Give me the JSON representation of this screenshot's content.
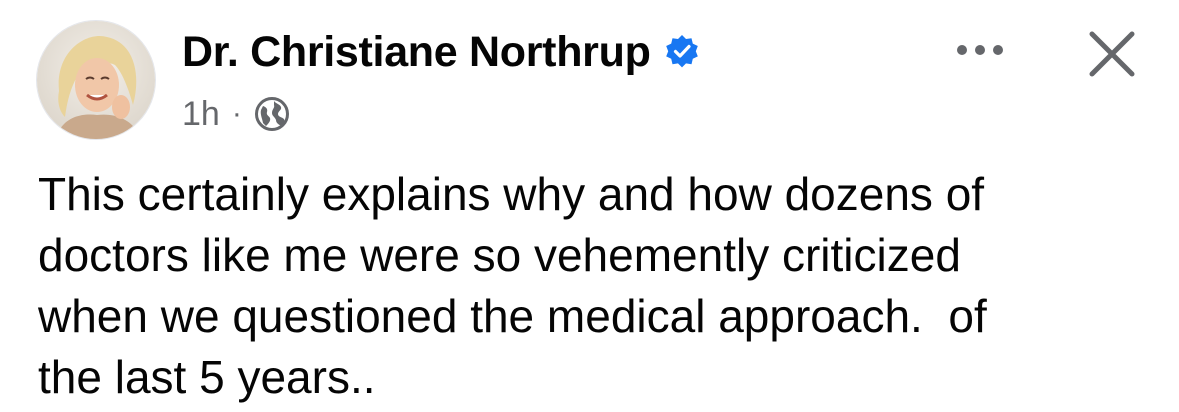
{
  "post": {
    "author": {
      "name": "Dr. Christiane Northrup",
      "verified": true,
      "avatar_icon": "profile-photo"
    },
    "meta": {
      "time": "1h",
      "separator": "·",
      "audience_icon": "globe-icon"
    },
    "actions": {
      "more_icon": "more-horizontal-icon",
      "close_icon": "close-icon"
    },
    "text": "This certainly explains why and how dozens of\ndoctors like me were so vehemently criticized\nwhen we questioned the medical approach.  of\nthe last 5 years.."
  },
  "colors": {
    "text_primary": "#050505",
    "text_secondary": "#65676b",
    "verified_badge": "#1877f2",
    "icon_gray": "#65676b"
  }
}
